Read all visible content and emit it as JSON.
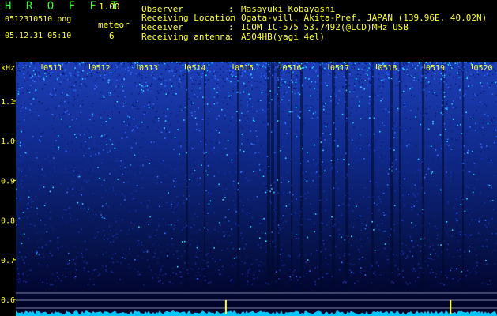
{
  "app": {
    "title": "H R O F F T",
    "version": "1.00",
    "filename": "0512310510.png",
    "datetime": "05.12.31 05:10",
    "meteor_label": "meteor",
    "meteor_count": "6"
  },
  "info": [
    {
      "label": "Observer",
      "value": "Masayuki Kobayashi"
    },
    {
      "label": "Receiving Location",
      "value": "Ogata-vill. Akita-Pref. JAPAN (139.96E, 40.02N)"
    },
    {
      "label": "Receiver",
      "value": "ICOM IC-575 53.7492(@LCD)MHz USB"
    },
    {
      "label": "Receiving antenna",
      "value": "A504HB(yagi 4el)"
    }
  ],
  "info_separator": ":",
  "colors": {
    "label_green": "#33ff33",
    "axis_yellow": "#ffff33",
    "spectrogram_bg": "#000016",
    "noise_blue": "#1a3fd0",
    "noise_cyan": "#22d8ff",
    "baseline_cyan": "#00e0ff"
  },
  "chart_data": {
    "type": "heatmap",
    "yunit": "kHz",
    "y_ticks": [
      "1.1",
      "1.0",
      "0.9",
      "0.8",
      "0.7",
      "0.6"
    ],
    "x_ticks": [
      "0511",
      "0512",
      "0513",
      "0514",
      "0515",
      "0516",
      "0517",
      "0518",
      "0519",
      "0520"
    ],
    "meteor_echo_times": [
      "0514.8",
      "0519.5"
    ]
  }
}
